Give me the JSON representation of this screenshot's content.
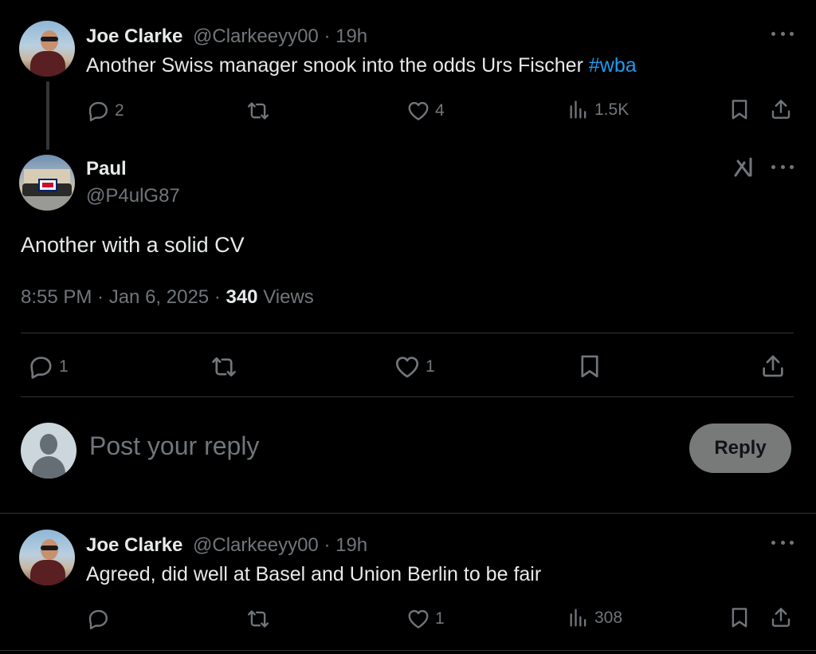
{
  "thread_parent": {
    "name": "Joe Clarke",
    "handle": "@Clarkeeyy00",
    "time": "· 19h",
    "text_before": "Another Swiss manager snook into the odds Urs Fischer ",
    "hashtag": "#wba",
    "replies": "2",
    "likes": "4",
    "views": "1.5K"
  },
  "main_post": {
    "name": "Paul",
    "handle": "@P4ulG87",
    "text": "Another with a solid CV",
    "timestamp": "8:55 PM · Jan 6, 2025 · ",
    "view_count": "340",
    "views_label": " Views",
    "replies": "1",
    "likes": "1"
  },
  "composer": {
    "placeholder": "Post your reply",
    "button_label": "Reply"
  },
  "reply_post": {
    "name": "Joe Clarke",
    "handle": "@Clarkeeyy00",
    "time": "· 19h",
    "text": "Agreed, did well at Basel and Union Berlin to be fair",
    "likes": "1",
    "views": "308"
  },
  "colors": {
    "background": "#000000",
    "text": "#e7e9ea",
    "muted": "#71767b",
    "accent": "#1d9bf0",
    "divider": "#2f3336",
    "reply_button": "#787a7a"
  },
  "icons": [
    "reply-icon",
    "repost-icon",
    "like-icon",
    "views-icon",
    "bookmark-icon",
    "share-icon",
    "more-icon",
    "grok-icon"
  ]
}
